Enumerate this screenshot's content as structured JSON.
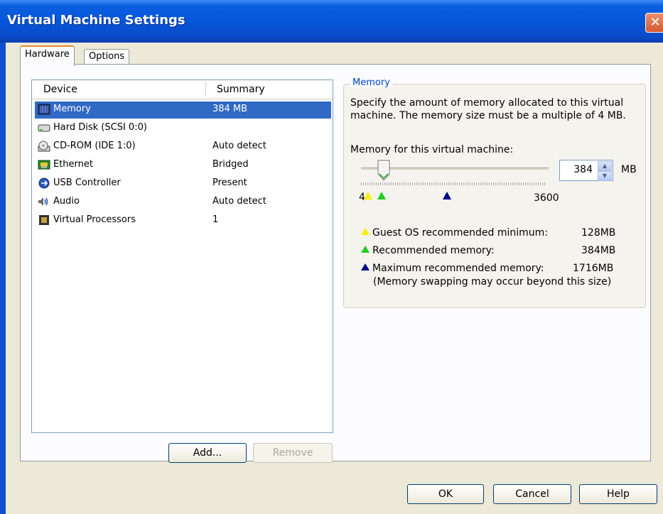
{
  "window": {
    "title": "Virtual Machine Settings",
    "close_glyph": "✕"
  },
  "tabs": [
    {
      "label": "Hardware",
      "active": true
    },
    {
      "label": "Options",
      "active": false
    }
  ],
  "device_list": {
    "columns": [
      "Device",
      "Summary"
    ],
    "rows": [
      {
        "icon": "memory-icon",
        "device": "Memory",
        "summary": "384 MB",
        "selected": true
      },
      {
        "icon": "hard-disk-icon",
        "device": "Hard Disk (SCSI 0:0)",
        "summary": ""
      },
      {
        "icon": "cdrom-icon",
        "device": "CD-ROM (IDE 1:0)",
        "summary": "Auto detect"
      },
      {
        "icon": "ethernet-icon",
        "device": "Ethernet",
        "summary": "Bridged"
      },
      {
        "icon": "usb-icon",
        "device": "USB Controller",
        "summary": "Present"
      },
      {
        "icon": "audio-icon",
        "device": "Audio",
        "summary": "Auto detect"
      },
      {
        "icon": "processor-icon",
        "device": "Virtual Processors",
        "summary": "1"
      }
    ]
  },
  "list_buttons": {
    "add": "Add...",
    "remove": "Remove"
  },
  "memory": {
    "group_title": "Memory",
    "description": "Specify the amount of memory allocated to this virtual machine. The memory size must be a multiple of 4 MB.",
    "field_label": "Memory for this virtual machine:",
    "value": "384",
    "unit": "MB",
    "slider_min_label": "4",
    "slider_max_label": "3600",
    "legend": [
      {
        "color": "#f4f000",
        "text": "Guest OS recommended minimum:",
        "value": "128MB"
      },
      {
        "color": "#22cc22",
        "text": "Recommended memory:",
        "value": "384MB"
      },
      {
        "color": "#00008b",
        "text": "Maximum recommended memory:",
        "value": "1716MB"
      }
    ],
    "note": "(Memory swapping may occur beyond this size)"
  },
  "dialog_buttons": {
    "ok": "OK",
    "cancel": "Cancel",
    "help": "Help"
  }
}
